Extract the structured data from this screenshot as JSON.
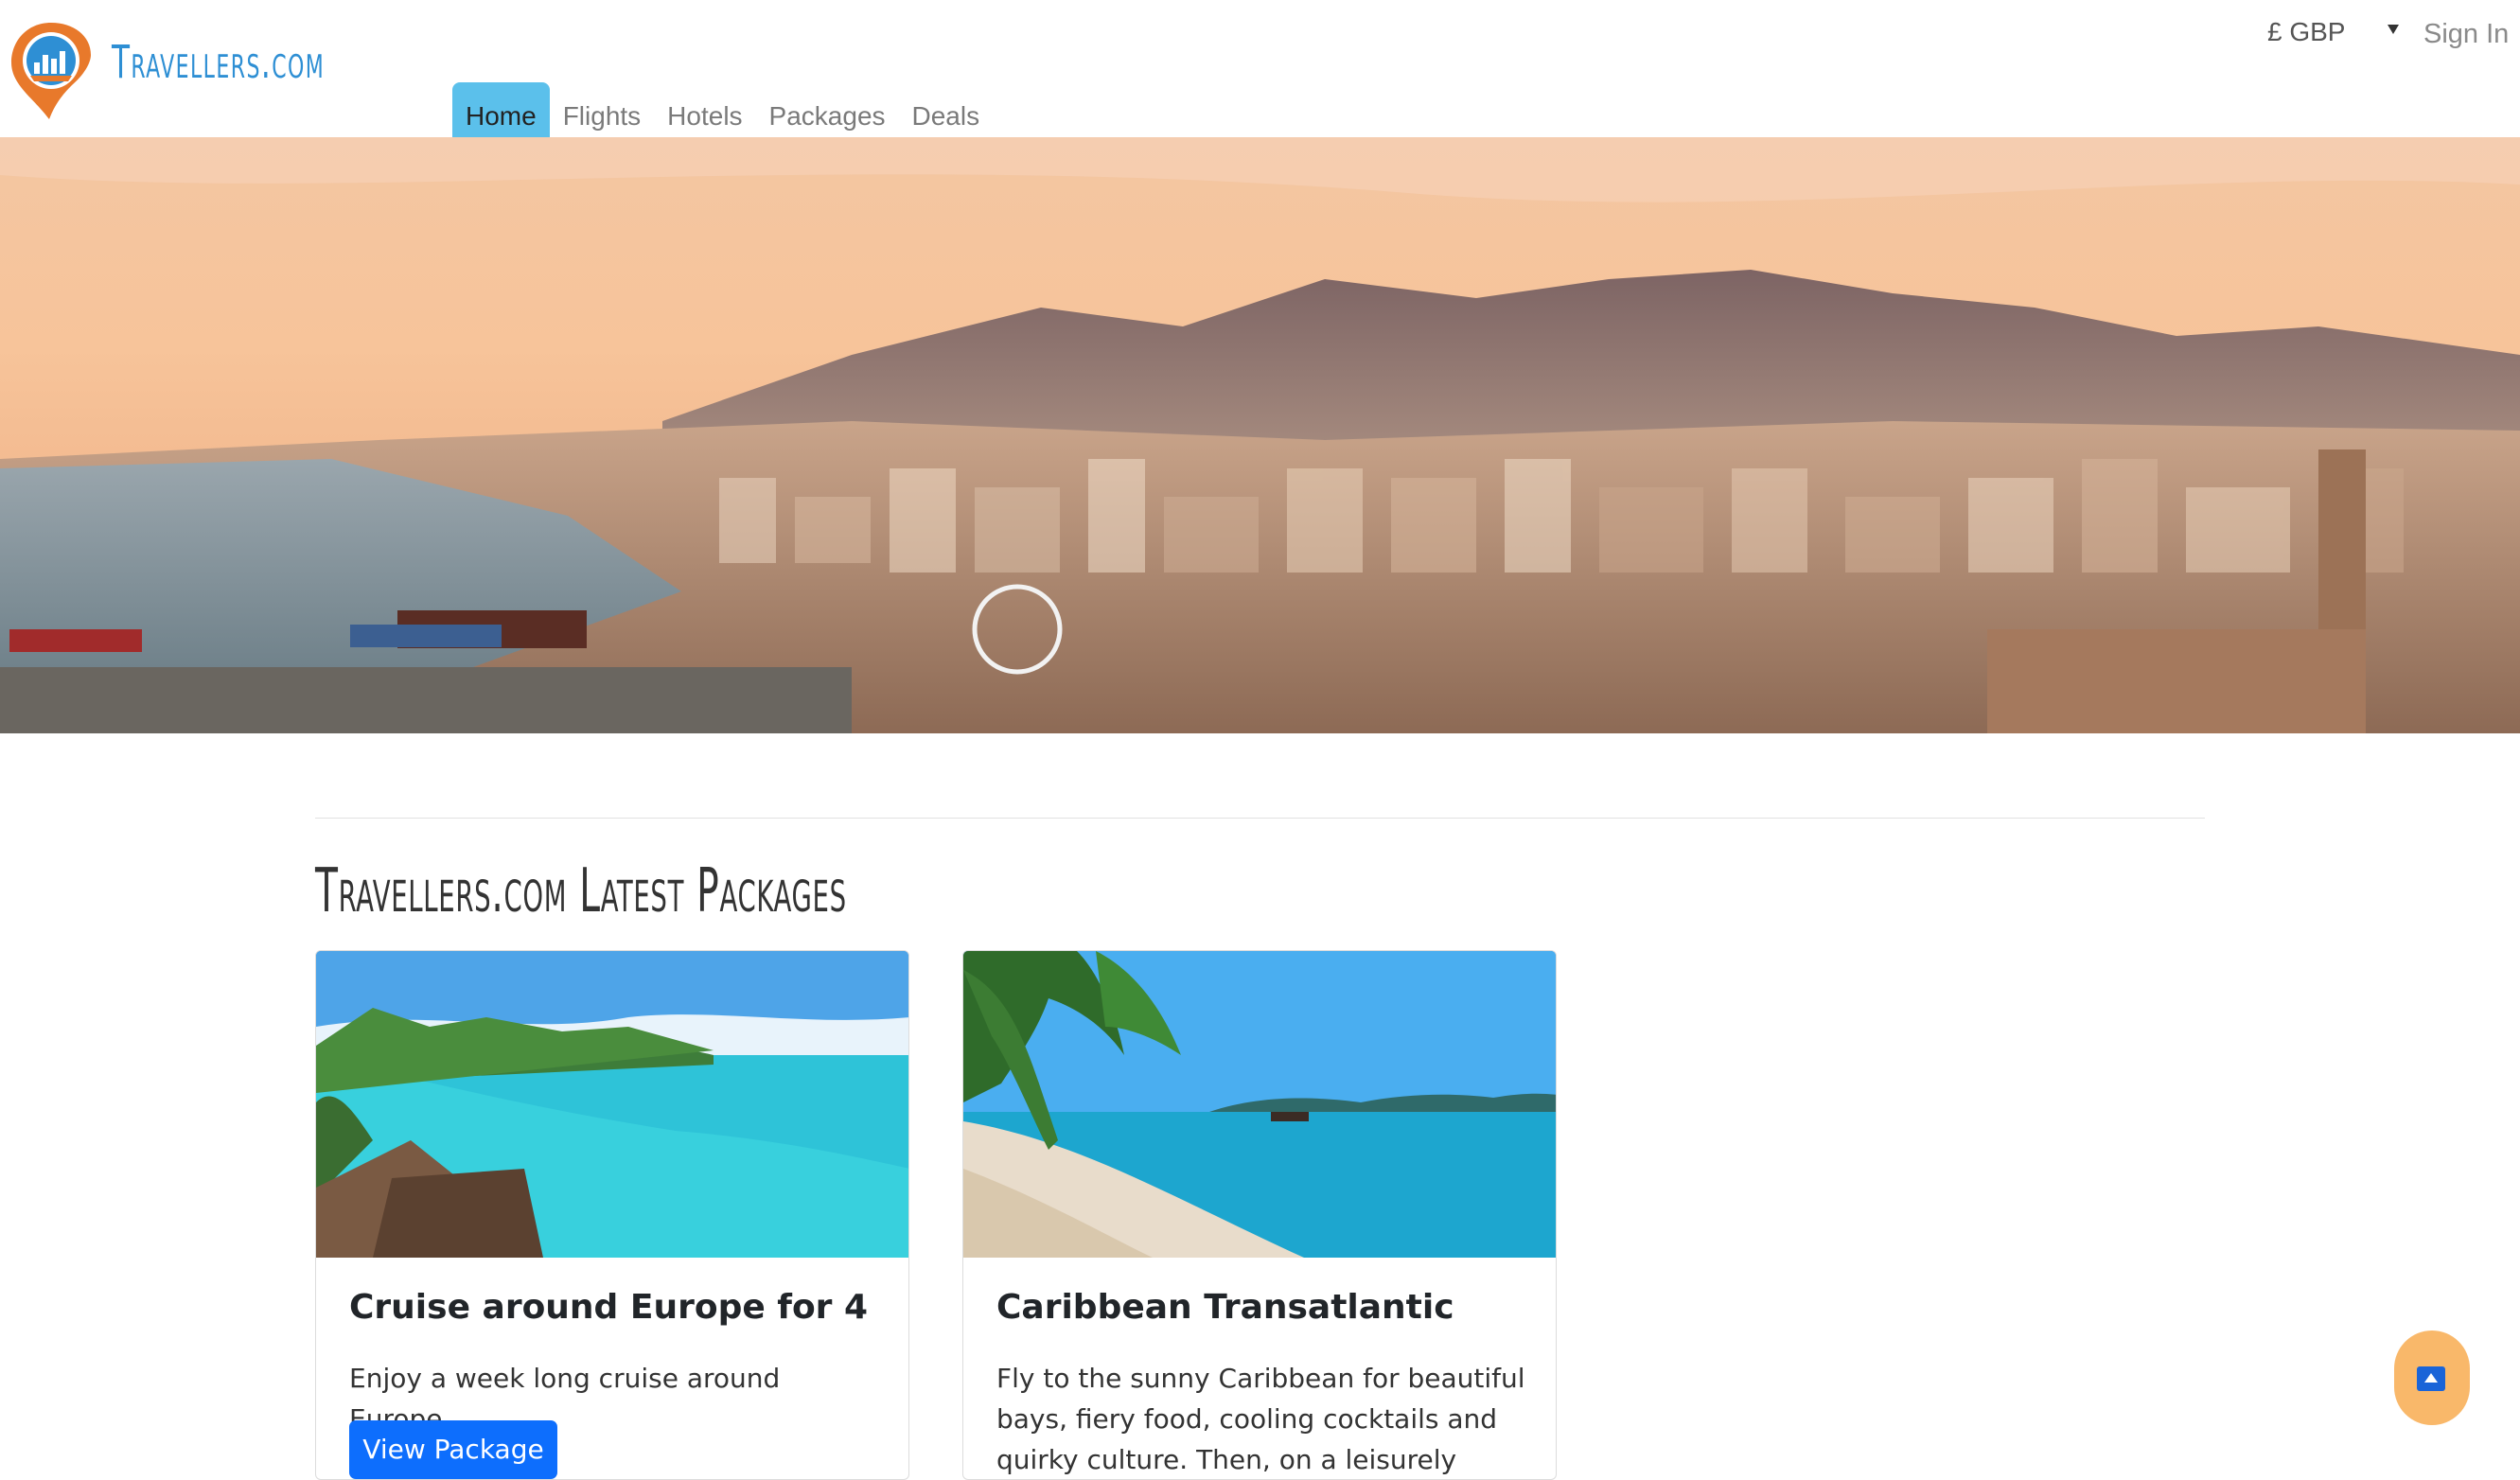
{
  "header": {
    "brand": "Travellers.com",
    "currency": "£ GBP",
    "sign_in": "Sign In"
  },
  "nav": {
    "items": [
      {
        "label": "Home",
        "active": true
      },
      {
        "label": "Flights",
        "active": false
      },
      {
        "label": "Hotels",
        "active": false
      },
      {
        "label": "Packages",
        "active": false
      },
      {
        "label": "Deals",
        "active": false
      }
    ]
  },
  "section": {
    "title": "Travellers.com Latest Packages"
  },
  "cards": [
    {
      "title": "Cruise around Europe for 4",
      "text": "Enjoy a week long cruise around Europe",
      "button": "View Package"
    },
    {
      "title": "Caribbean Transatlantic",
      "text": "Fly to the sunny Caribbean for beautiful bays, fiery food, cooling cocktails and quirky culture. Then, on a leisurely sailing"
    }
  ],
  "colors": {
    "accent": "#5bc0eb",
    "brand": "#2e8fd4",
    "primary_button": "#0d6efd",
    "scroll_button": "#f9b86a"
  }
}
